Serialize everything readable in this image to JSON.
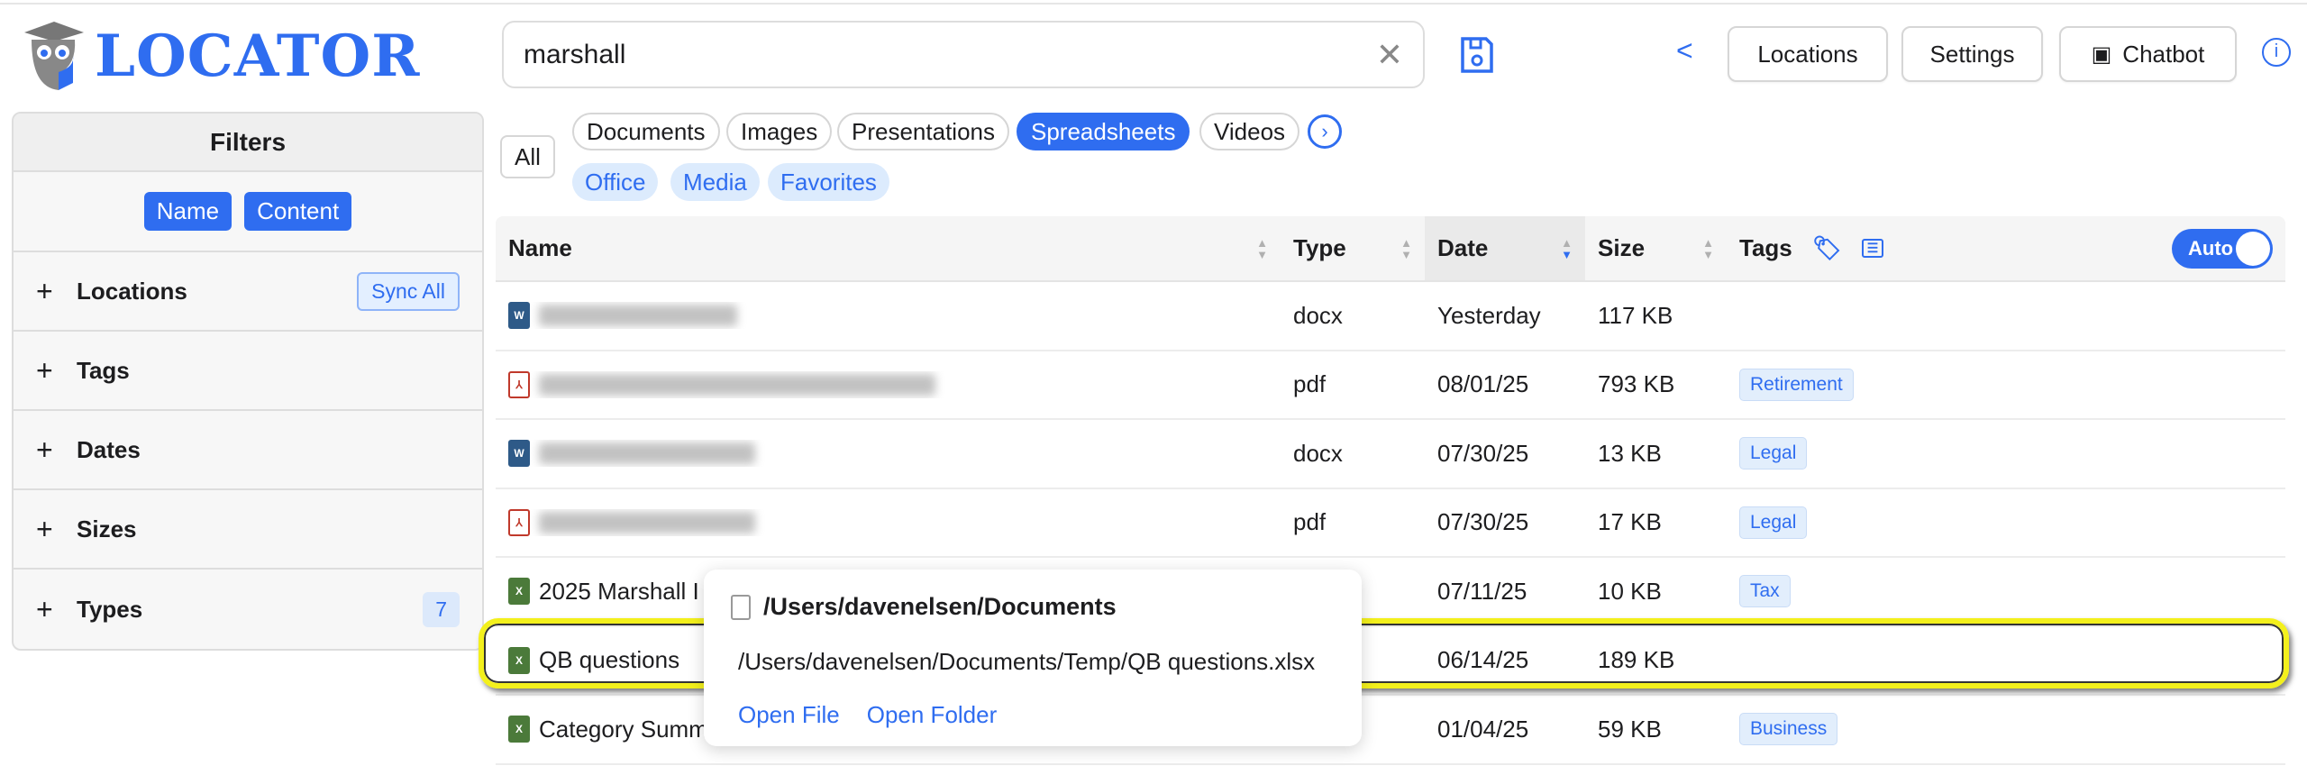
{
  "app": {
    "logo_text": "LOCATOR"
  },
  "search": {
    "value": "marshall"
  },
  "header": {
    "back": "<",
    "locations": "Locations",
    "settings": "Settings",
    "chatbot": "Chatbot"
  },
  "filters": {
    "title": "Filters",
    "name": "Name",
    "content": "Content",
    "sync_all": "Sync All",
    "rows": [
      {
        "label": "Locations"
      },
      {
        "label": "Tags"
      },
      {
        "label": "Dates"
      },
      {
        "label": "Sizes"
      },
      {
        "label": "Types",
        "count": "7"
      }
    ]
  },
  "chips": {
    "all": "All",
    "documents": "Documents",
    "images": "Images",
    "presentations": "Presentations",
    "spreadsheets": "Spreadsheets",
    "videos": "Videos",
    "office": "Office",
    "media": "Media",
    "favorites": "Favorites"
  },
  "table": {
    "headers": {
      "name": "Name",
      "type": "Type",
      "date": "Date",
      "size": "Size",
      "tags": "Tags",
      "auto": "Auto"
    },
    "rows": [
      {
        "name": "",
        "type": "docx",
        "date": "Yesterday",
        "size": "117 KB",
        "tag": ""
      },
      {
        "name": "",
        "type": "pdf",
        "date": "08/01/25",
        "size": "793 KB",
        "tag": "Retirement"
      },
      {
        "name": "",
        "type": "docx",
        "date": "07/30/25",
        "size": "13 KB",
        "tag": "Legal"
      },
      {
        "name": "",
        "type": "pdf",
        "date": "07/30/25",
        "size": "17 KB",
        "tag": "Legal"
      },
      {
        "name": "2025 Marshall I",
        "type": "",
        "date": "07/11/25",
        "size": "10 KB",
        "tag": "Tax"
      },
      {
        "name": "QB questions",
        "type": "",
        "date": "06/14/25",
        "size": "189 KB",
        "tag": ""
      },
      {
        "name": "Category Summ",
        "type": "",
        "date": "01/04/25",
        "size": "59 KB",
        "tag": "Business"
      }
    ]
  },
  "popover": {
    "folder": "/Users/davenelsen/Documents",
    "path": "/Users/davenelsen/Documents/Temp/QB questions.xlsx",
    "open_file": "Open File",
    "open_folder": "Open Folder"
  },
  "colors": {
    "accent": "#2f6df0",
    "highlight": "#f3f01c"
  }
}
